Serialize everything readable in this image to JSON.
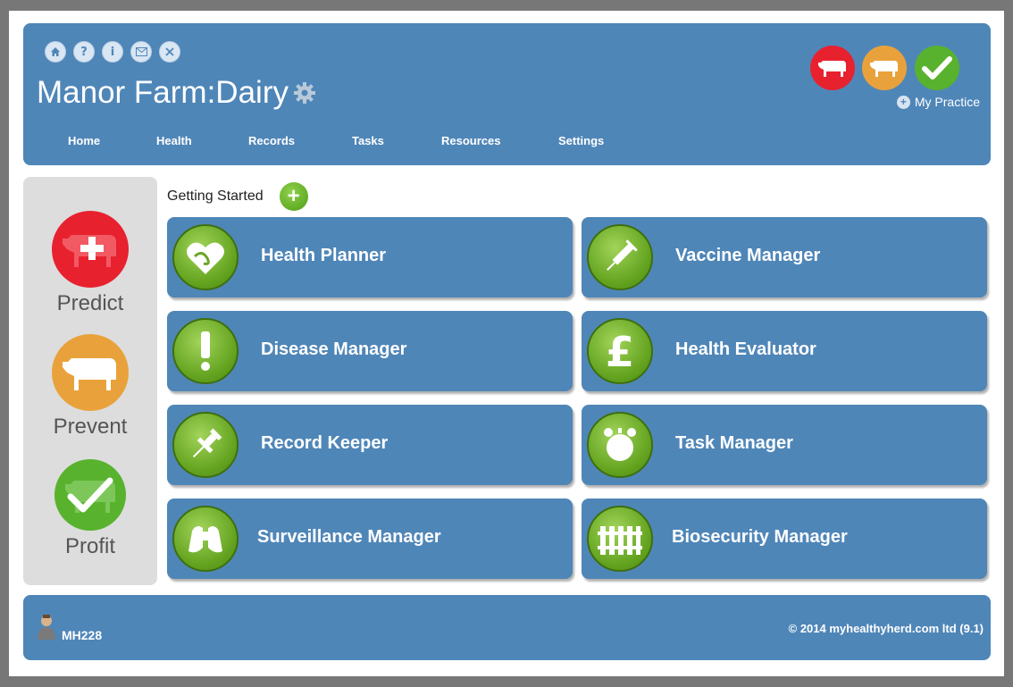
{
  "header": {
    "title": "Manor Farm:Dairy",
    "top_icons": [
      "home-icon",
      "help-icon",
      "info-icon",
      "mail-icon",
      "close-icon"
    ],
    "my_practice_label": "My Practice",
    "status_colors": {
      "red": "#e8212f",
      "orange": "#e9a23b",
      "green": "#58b22e"
    }
  },
  "nav": {
    "items": [
      "Home",
      "Health",
      "Records",
      "Tasks",
      "Resources",
      "Settings"
    ]
  },
  "sidebar": {
    "items": [
      {
        "label": "Predict",
        "icon": "cow-plus-icon",
        "color": "#e8212f"
      },
      {
        "label": "Prevent",
        "icon": "cow-icon",
        "color": "#e9a23b"
      },
      {
        "label": "Profit",
        "icon": "cow-check-icon",
        "color": "#58b22e"
      }
    ]
  },
  "getting_started": {
    "label": "Getting Started"
  },
  "tiles": [
    {
      "label": "Health Planner",
      "icon": "heart-icon"
    },
    {
      "label": "Vaccine Manager",
      "icon": "syringe-icon"
    },
    {
      "label": "Disease Manager",
      "icon": "exclamation-icon"
    },
    {
      "label": "Health Evaluator",
      "icon": "pound-icon"
    },
    {
      "label": "Record Keeper",
      "icon": "pushpin-icon"
    },
    {
      "label": "Task Manager",
      "icon": "alarm-clock-icon"
    },
    {
      "label": "Surveillance Manager",
      "icon": "binoculars-icon"
    },
    {
      "label": "Biosecurity Manager",
      "icon": "fence-icon"
    }
  ],
  "footer": {
    "user": "MH228",
    "copyright": "© 2014  myhealthyherd.com ltd (9.1)"
  },
  "colors": {
    "accent": "#4f86b8",
    "sidebar_bg": "#dddddd",
    "tile_icon_green": "#6aa724"
  }
}
